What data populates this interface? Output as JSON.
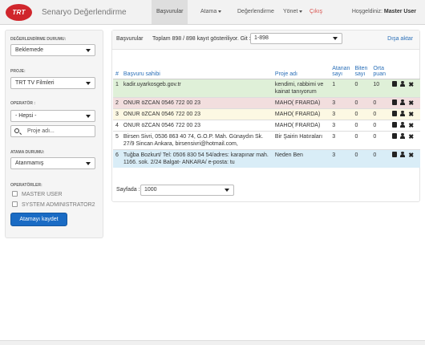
{
  "header": {
    "logo_text": "TRT",
    "brand": "Senaryo Değerlendirme",
    "nav": [
      "Başvurular",
      "Atama",
      "Değerlendirme",
      "Yönet",
      "Çıkış"
    ],
    "greeting": "Hoşgeldiniz:",
    "user": "Master User"
  },
  "sidebar": {
    "status_label": "DEĞERLENDİRME DURUMU:",
    "status_value": "Beklemede",
    "project_label": "PROJE:",
    "project_value": "TRT TV Filmleri",
    "operator_label": "OPERATÖR :",
    "operator_value": "- Hepsi -",
    "search_placeholder": "Proje adı...",
    "assign_label": "ATAMA DURUMU:",
    "assign_value": "Atanmamış",
    "operators_label": "OPERATÖRLER:",
    "operators": [
      "MASTER USER",
      "SYSTEM ADMINISTRATOR2"
    ],
    "save_button": "Atamayı kaydet"
  },
  "toolbar": {
    "title": "Başvurular",
    "summary": "Toplam 898 / 898 kayıt gösteriliyor. Git :",
    "page_range": "1-898",
    "export": "Dışa aktar"
  },
  "table": {
    "headers": [
      "#",
      "Başvuru sahibi",
      "Proje adı",
      "Atanan sayı",
      "Biten sayı",
      "Orta puan"
    ],
    "rows": [
      {
        "n": "1",
        "owner": "kadir.uyarkosgeb.gov.tr",
        "project": "kendimi, rabbimi ve kainat tanıyorum",
        "assigned": "1",
        "done": "0",
        "avg": "10"
      },
      {
        "n": "2",
        "owner": "ONUR öZCAN 0546 722 00 23",
        "project": "MAHO( FRARDA)",
        "assigned": "3",
        "done": "0",
        "avg": "0"
      },
      {
        "n": "3",
        "owner": "ONUR öZCAN 0546 722 00 23",
        "project": "MAHO( FRARDA)",
        "assigned": "3",
        "done": "0",
        "avg": "0"
      },
      {
        "n": "4",
        "owner": "ONUR öZCAN 0546 722 00 23",
        "project": "MAHO( FRARDA)",
        "assigned": "3",
        "done": "0",
        "avg": "0"
      },
      {
        "n": "5",
        "owner": "Birsen Sivri, 0536 863 40 74, G.O.P. Mah. Günaydın Sk. 27/9 Sincan Ankara, birsensivri@hotmail.com,",
        "project": "Bir Şairin Hatıraları",
        "assigned": "3",
        "done": "0",
        "avg": "0"
      },
      {
        "n": "6",
        "owner": "Tuğba Bozkurt/ Tel: 0506 830 54 54/adres: karapınar mah. 1166. sok. 2/24 Balgat- ANKARA/ e-posta: tu",
        "project": "Neden Ben",
        "assigned": "3",
        "done": "0",
        "avg": "0"
      }
    ]
  },
  "pager": {
    "label": "Sayfada :",
    "value": "1000"
  }
}
